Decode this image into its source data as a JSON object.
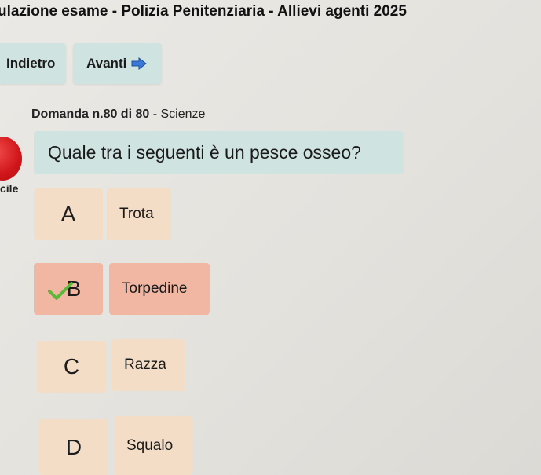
{
  "header": {
    "title": "ulazione esame - Polizia Penitenziaria - Allievi agenti 2025"
  },
  "nav": {
    "back_label": "Indietro",
    "next_label": "Avanti",
    "next_icon": "arrow-right-icon"
  },
  "question": {
    "counter": "Domanda n.80 di 80",
    "subject": "- Scienze",
    "text": "Quale tra i seguenti è un pesce osseo?",
    "difficulty_label": "cile",
    "difficulty_color": "#d0161a"
  },
  "answers": [
    {
      "letter": "A",
      "text": "Trota",
      "correct": false
    },
    {
      "letter": "B",
      "text": "Torpedine",
      "correct": true
    },
    {
      "letter": "C",
      "text": "Razza",
      "correct": false
    },
    {
      "letter": "D",
      "text": "Squalo",
      "correct": false
    }
  ],
  "colors": {
    "nav_bg": "#cfe3e0",
    "answer_bg": "#f4ddc6",
    "answer_selected_bg": "#f2b7a2",
    "check": "#5db83a"
  }
}
